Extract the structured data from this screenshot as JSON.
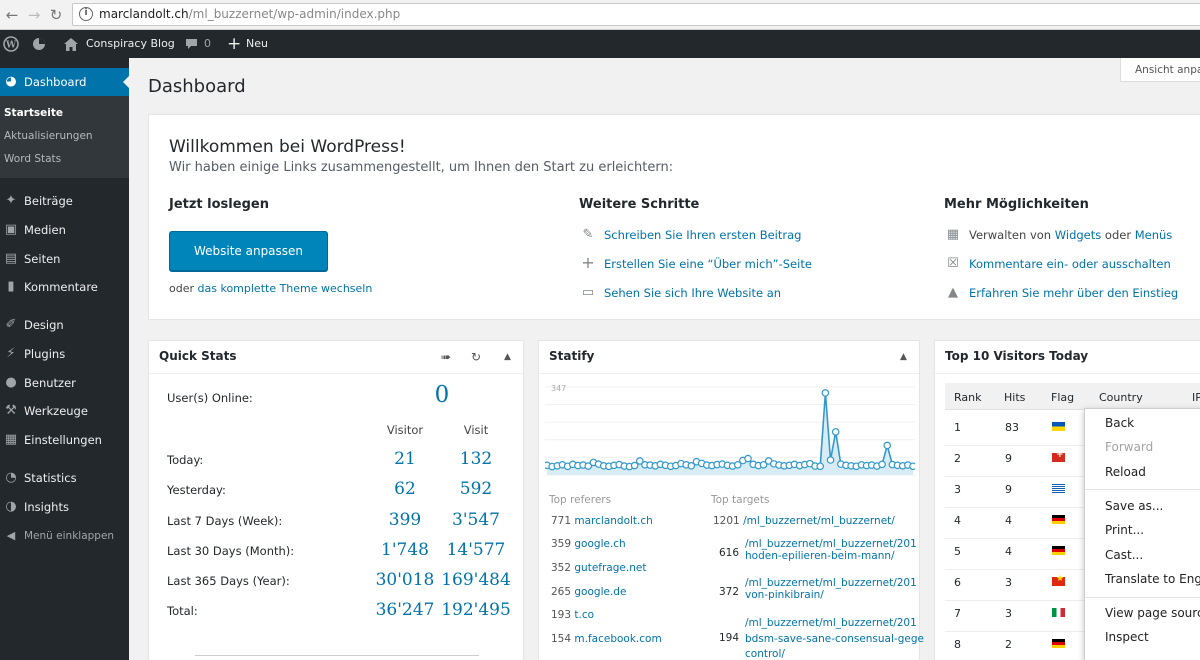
{
  "browser": {
    "url_host": "marclandolt.ch",
    "url_path": "/ml_buzzernet/wp-admin/index.php"
  },
  "adminbar": {
    "site_name": "Conspiracy Blog",
    "comments_count": "0",
    "new_label": "Neu"
  },
  "sidebar": {
    "dashboard": "Dashboard",
    "submenu": [
      "Startseite",
      "Aktualisierungen",
      "Word Stats"
    ],
    "items": [
      "Beiträge",
      "Medien",
      "Seiten",
      "Kommentare",
      "Design",
      "Plugins",
      "Benutzer",
      "Werkzeuge",
      "Einstellungen",
      "Statistics",
      "Insights"
    ],
    "collapse": "Menü einklappen"
  },
  "page": {
    "title": "Dashboard",
    "screen_options": "Ansicht anpassen"
  },
  "welcome": {
    "title": "Willkommen bei WordPress!",
    "about": "Wir haben einige Links zusammengestellt, um Ihnen den Start zu erleichtern:",
    "col1_title": "Jetzt loslegen",
    "button": "Website anpassen",
    "or_text": "oder",
    "or_link": "das komplette Theme wechseln",
    "col2_title": "Weitere Schritte",
    "steps": [
      "Schreiben Sie Ihren ersten Beitrag",
      "Erstellen Sie eine “Über mich”-Seite",
      "Sehen Sie sich Ihre Website an"
    ],
    "col3_title": "Mehr Möglichkeiten",
    "more_1_pre": "Verwalten von",
    "more_1_link1": "Widgets",
    "more_1_mid": "oder",
    "more_1_link2": "Menüs",
    "more_2": "Kommentare ein- oder ausschalten",
    "more_3": "Erfahren Sie mehr über den Einstieg"
  },
  "quick_stats": {
    "title": "Quick Stats",
    "online_label": "User(s) Online:",
    "online_value": "0",
    "col_visitor": "Visitor",
    "col_visit": "Visit",
    "rows": [
      {
        "label": "Today:",
        "visitor": "21",
        "visit": "132"
      },
      {
        "label": "Yesterday:",
        "visitor": "62",
        "visit": "592"
      },
      {
        "label": "Last 7 Days (Week):",
        "visitor": "399",
        "visit": "3'547"
      },
      {
        "label": "Last 30 Days (Month):",
        "visitor": "1'748",
        "visit": "14'577"
      },
      {
        "label": "Last 365 Days (Year):",
        "visitor": "30'018",
        "visit": "169'484"
      },
      {
        "label": "Total:",
        "visitor": "36'247",
        "visit": "192'495"
      }
    ]
  },
  "statify": {
    "title": "Statify",
    "max_label": "347",
    "referers_title": "Top referers",
    "targets_title": "Top targets",
    "referers": [
      {
        "count": "771",
        "name": "marclandolt.ch"
      },
      {
        "count": "359",
        "name": "google.ch"
      },
      {
        "count": "352",
        "name": "gutefrage.net"
      },
      {
        "count": "265",
        "name": "google.de"
      },
      {
        "count": "193",
        "name": "t.co"
      },
      {
        "count": "154",
        "name": "m.facebook.com"
      }
    ],
    "targets": [
      {
        "count": "1201",
        "line1": "/ml_buzzernet/ml_buzzernet/",
        "line2": ""
      },
      {
        "count": "616",
        "line1": "/ml_buzzernet/ml_buzzernet/201",
        "line2": "hoden-epilieren-beim-mann/"
      },
      {
        "count": "372",
        "line1": "/ml_buzzernet/ml_buzzernet/201",
        "line2": "von-pinkibrain/"
      },
      {
        "count": "194",
        "line1": "/ml_buzzernet/ml_buzzernet/201",
        "line2": "bdsm-save-sane-consensual-gege",
        "line3": "control/"
      }
    ]
  },
  "chart_data": {
    "type": "line",
    "title": "",
    "ymax_label": "347",
    "values": [
      40,
      35,
      38,
      42,
      36,
      44,
      39,
      41,
      37,
      52,
      45,
      38,
      36,
      40,
      43,
      37,
      35,
      39,
      58,
      42,
      41,
      38,
      44,
      40,
      36,
      39,
      47,
      42,
      38,
      55,
      48,
      41,
      39,
      43,
      45,
      40,
      37,
      42,
      60,
      68,
      44,
      39,
      42,
      58,
      46,
      41,
      38,
      40,
      44,
      39,
      43,
      47,
      37,
      36,
      339,
      62,
      178,
      45,
      40,
      38,
      36,
      42,
      39,
      41,
      37,
      44,
      122,
      43,
      40,
      38,
      41,
      36
    ]
  },
  "top_visitors": {
    "title": "Top 10 Visitors Today",
    "headers": [
      "Rank",
      "Hits",
      "Flag",
      "Country",
      "IP"
    ],
    "rows": [
      {
        "rank": "1",
        "hits": "83",
        "flag_colors": [
          "#0057b7",
          "#ffd700"
        ]
      },
      {
        "rank": "2",
        "hits": "9",
        "flag_colors": [
          "#d52b1e",
          "#ffffff"
        ]
      },
      {
        "rank": "3",
        "hits": "9",
        "flag_colors": [
          "#0d5eaf",
          "#ffffff"
        ]
      },
      {
        "rank": "4",
        "hits": "4",
        "flag_colors": [
          "#000000",
          "#dd0000",
          "#ffce00"
        ]
      },
      {
        "rank": "5",
        "hits": "4",
        "flag_colors": [
          "#000000",
          "#dd0000",
          "#ffce00"
        ]
      },
      {
        "rank": "6",
        "hits": "3",
        "flag_colors": [
          "#de2910",
          "#ffde00"
        ]
      },
      {
        "rank": "7",
        "hits": "3",
        "flag_colors": [
          "#009246",
          "#ffffff",
          "#ce2b37"
        ]
      },
      {
        "rank": "8",
        "hits": "2",
        "flag_colors": [
          "#000000",
          "#dd0000",
          "#ffce00"
        ]
      }
    ]
  },
  "context_menu": {
    "items": [
      "Back",
      "Forward",
      "Reload",
      "Save as...",
      "Print...",
      "Cast...",
      "Translate to English",
      "View page source",
      "Inspect"
    ]
  },
  "colors": {
    "accent": "#0073aa",
    "adminbar": "#23282d",
    "button": "#0085ba"
  }
}
